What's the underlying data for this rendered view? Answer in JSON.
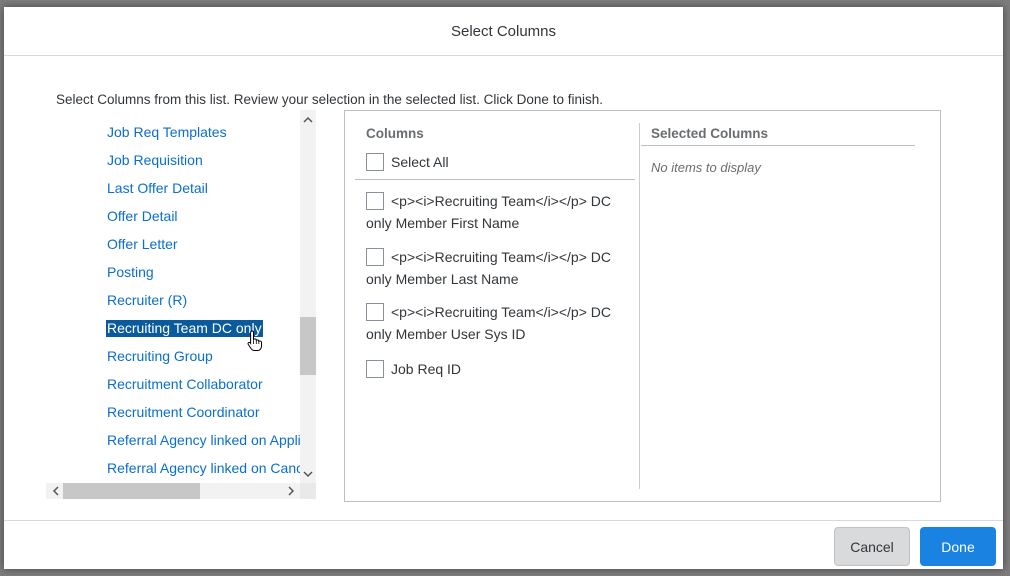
{
  "dialog": {
    "title": "Select Columns",
    "instructions": "Select Columns from this list. Review your selection in the selected list. Click Done to finish."
  },
  "left_list": {
    "items": [
      "Job Req Templates",
      "Job Requisition",
      "Last Offer Detail",
      "Offer Detail",
      "Offer Letter",
      "Posting",
      "Recruiter (R)",
      "Recruiting Team DC only",
      "Recruiting Group",
      "Recruitment Collaborator",
      "Recruitment Coordinator",
      "Referral Agency linked on Appli",
      "Referral Agency linked on Canc"
    ],
    "selected_index": 7
  },
  "columns": {
    "heading": "Columns",
    "select_all": "Select All",
    "options": [
      {
        "line1": "<p><i>Recruiting Team</i></p> DC",
        "line2": "only Member First Name",
        "checked": false
      },
      {
        "line1": "<p><i>Recruiting Team</i></p> DC",
        "line2": "only Member Last Name",
        "checked": false
      },
      {
        "line1": "<p><i>Recruiting Team</i></p> DC",
        "line2": "only Member User Sys ID",
        "checked": false
      },
      {
        "line1": "Job Req ID",
        "line2": "",
        "checked": false
      }
    ]
  },
  "selected_columns": {
    "heading": "Selected Columns",
    "empty_text": "No items to display"
  },
  "footer": {
    "cancel_label": "Cancel",
    "done_label": "Done"
  },
  "colors": {
    "link": "#0a6ed1",
    "selected_bg": "#0a5a9e",
    "primary_button": "#1a83e2"
  },
  "icons": [
    "chevron-up-icon",
    "chevron-down-icon",
    "chevron-left-icon",
    "chevron-right-icon",
    "hand-pointer-icon"
  ]
}
